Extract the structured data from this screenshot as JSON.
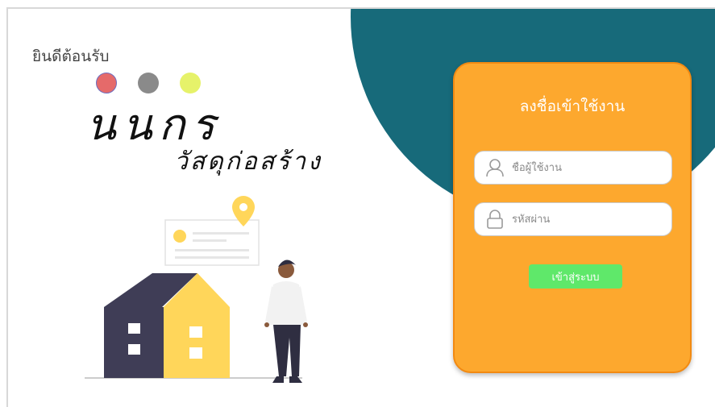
{
  "welcome": "ยินดีต้อนรับ",
  "brand": {
    "name": "นนกร",
    "subtitle": "วัสดุก่อสร้าง"
  },
  "colors": {
    "teal": "#176a7a",
    "card": "#fda82e",
    "button": "#5fe86a",
    "dot_red": "#e56a6a",
    "dot_gray": "#8a8a8a",
    "dot_yellow": "#e6f26a"
  },
  "login": {
    "title": "ลงชื่อเข้าใช้งาน",
    "username_placeholder": "ชื่อผู้ใช้งาน",
    "password_placeholder": "รหัสผ่าน",
    "button_label": "เข้าสู่ระบบ",
    "username_icon": "user-icon",
    "password_icon": "lock-icon"
  }
}
